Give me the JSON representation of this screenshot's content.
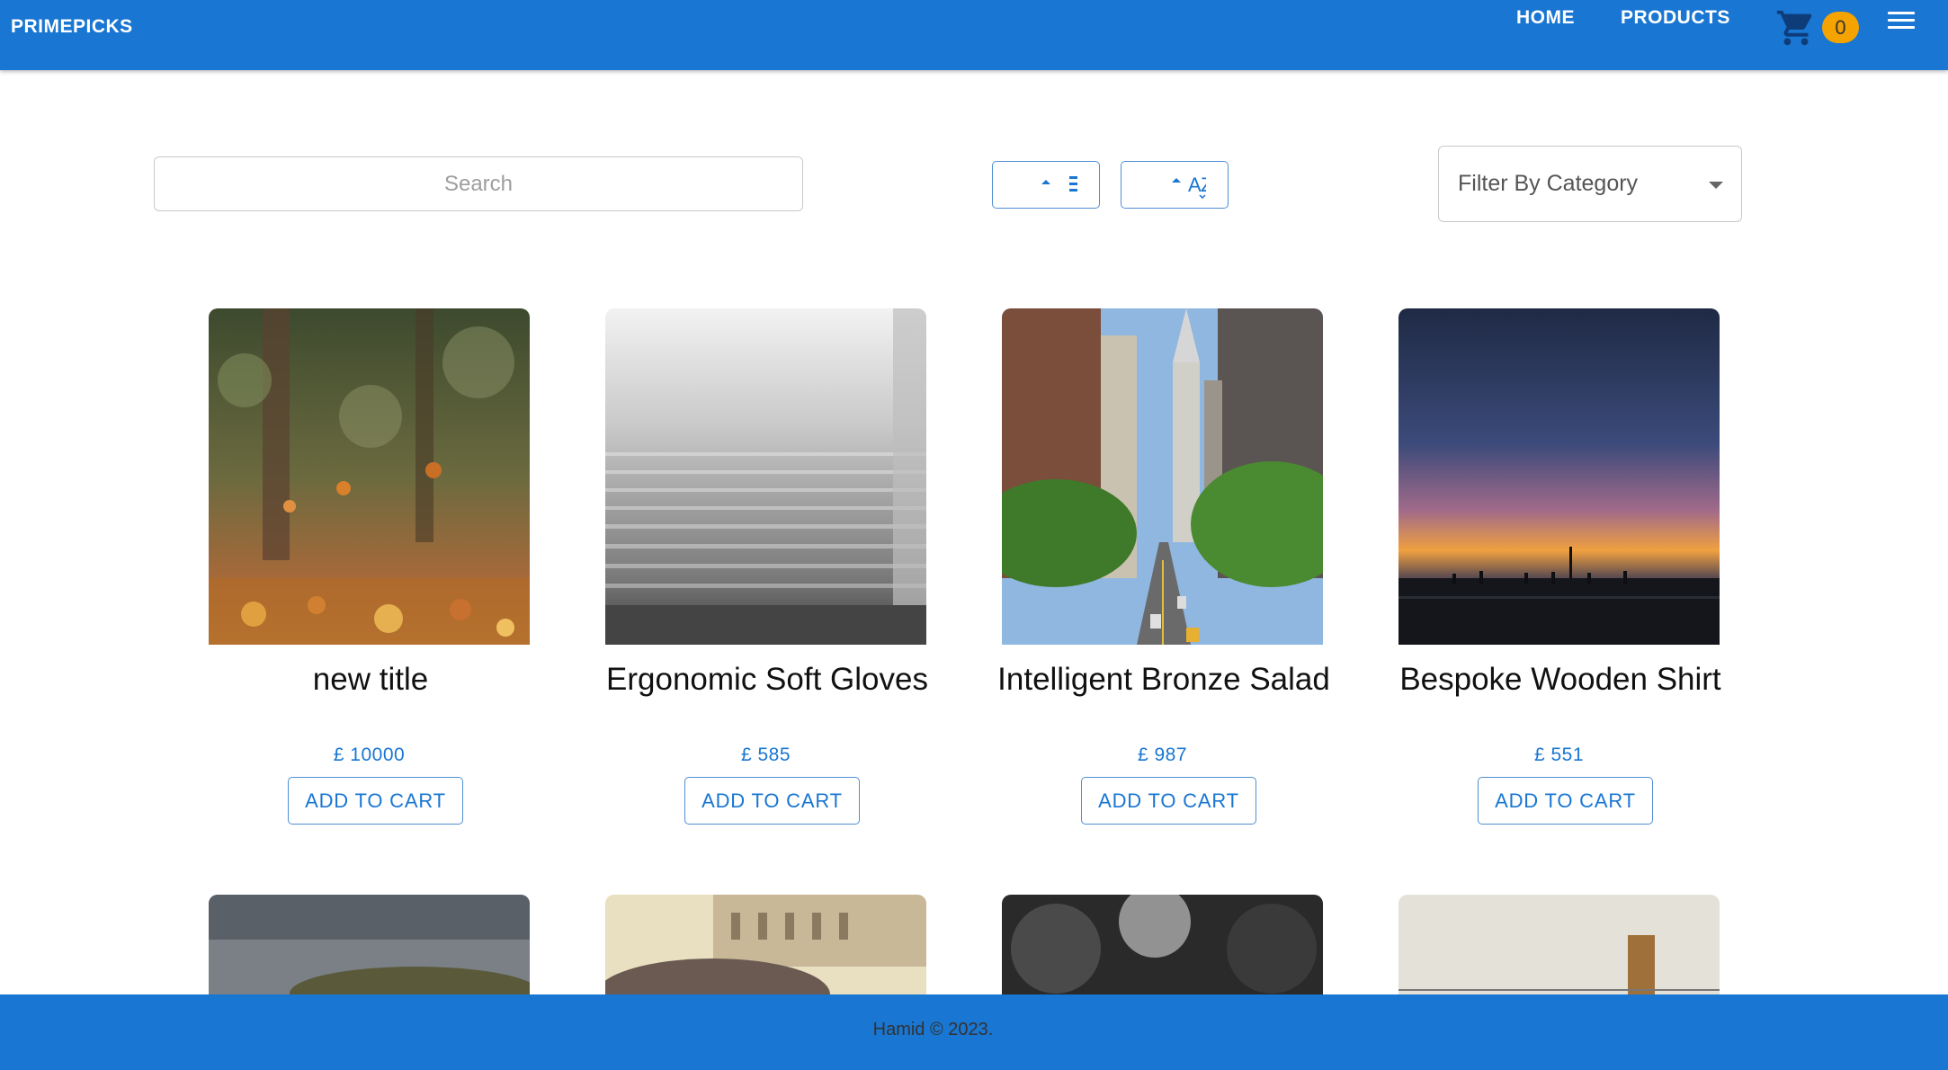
{
  "header": {
    "brand": "PRIMEPICKS",
    "nav": [
      "HOME",
      "PRODUCTS"
    ],
    "cart_count": "0",
    "colors": {
      "bar": "#1976d2",
      "badge": "#f5a300"
    }
  },
  "toolbar": {
    "search_placeholder": "Search",
    "sort_price_icon": "sort-arrow-up-lines-icon",
    "sort_name_icon": "sort-arrow-up-az-icon",
    "filter_label": "Filter By Category"
  },
  "products": [
    {
      "title": "new title",
      "price": "£ 10000",
      "button": "ADD TO CART",
      "image": "autumn-leaves"
    },
    {
      "title": "Ergonomic Soft Gloves",
      "price": "£ 585",
      "button": "ADD TO CART",
      "image": "misty-stairs"
    },
    {
      "title": "Intelligent Bronze Salad",
      "price": "£ 987",
      "button": "ADD TO CART",
      "image": "city-street"
    },
    {
      "title": "Bespoke Wooden Shirt",
      "price": "£ 551",
      "button": "ADD TO CART",
      "image": "sunset-pier"
    }
  ],
  "next_row_images": [
    "stormy-hills",
    "vintage-car",
    "forest-canopy",
    "wooden-post"
  ],
  "footer": {
    "text": "Hamid © 2023."
  }
}
